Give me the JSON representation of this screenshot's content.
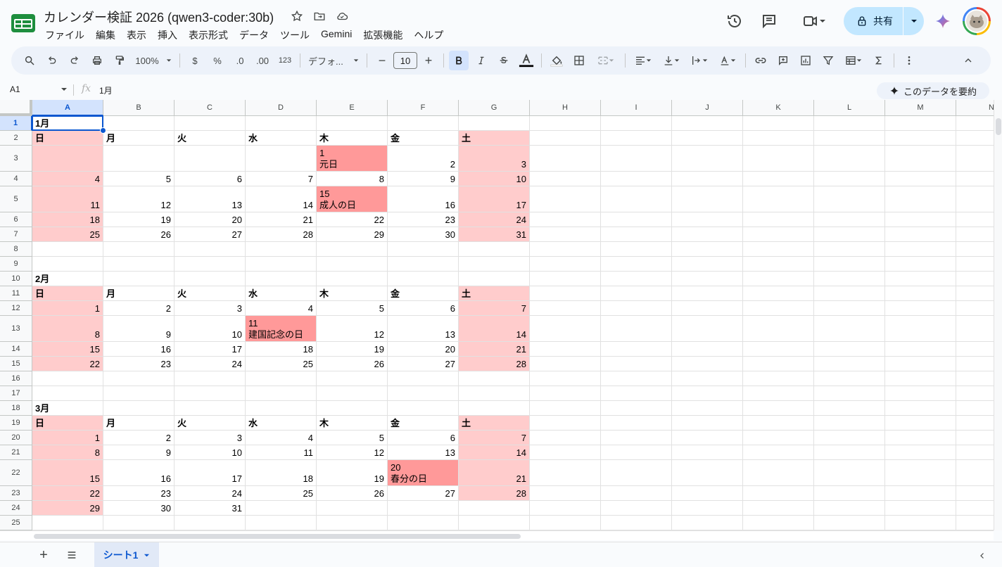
{
  "app": {
    "doc_title": "カレンダー検証 2026 (qwen3-coder:30b)",
    "menu": [
      "ファイル",
      "編集",
      "表示",
      "挿入",
      "表示形式",
      "データ",
      "ツール",
      "Gemini",
      "拡張機能",
      "ヘルプ"
    ],
    "share_label": "共有"
  },
  "toolbar": {
    "zoom": "100%",
    "currency": "$",
    "percent": "%",
    "dec_decrease": ".0",
    "dec_increase": ".00",
    "format_123": "123",
    "font_name": "デフォ...",
    "font_size": "10",
    "minus": "−",
    "plus": "+"
  },
  "formula_bar": {
    "name_box": "A1",
    "fx": "fx",
    "value": "1月",
    "summarize_label": "このデータを要約"
  },
  "grid": {
    "columns": [
      "A",
      "B",
      "C",
      "D",
      "E",
      "F",
      "G",
      "H",
      "I",
      "J",
      "K",
      "L",
      "M",
      "N"
    ],
    "rows": [
      "1",
      "2",
      "3",
      "4",
      "5",
      "6",
      "7",
      "8",
      "9",
      "10",
      "11",
      "12",
      "13",
      "14",
      "15",
      "16",
      "17",
      "18",
      "19",
      "20",
      "21",
      "22",
      "23",
      "24",
      "25"
    ],
    "selected_cell": "A1",
    "cells": [
      {
        "r": 1,
        "c": 0,
        "v": "1月",
        "bold": true
      },
      {
        "r": 2,
        "c": 0,
        "v": "日",
        "bold": true,
        "bg": "we"
      },
      {
        "r": 2,
        "c": 1,
        "v": "月",
        "bold": true
      },
      {
        "r": 2,
        "c": 2,
        "v": "火",
        "bold": true
      },
      {
        "r": 2,
        "c": 3,
        "v": "水",
        "bold": true
      },
      {
        "r": 2,
        "c": 4,
        "v": "木",
        "bold": true
      },
      {
        "r": 2,
        "c": 5,
        "v": "金",
        "bold": true
      },
      {
        "r": 2,
        "c": 6,
        "v": "土",
        "bold": true,
        "bg": "we"
      },
      {
        "r": 3,
        "c": 0,
        "v": "",
        "bg": "we"
      },
      {
        "r": 3,
        "c": 4,
        "v": "1\n元日",
        "bg": "hol",
        "multi": true
      },
      {
        "r": 3,
        "c": 5,
        "v": "2"
      },
      {
        "r": 3,
        "c": 6,
        "v": "3",
        "bg": "we"
      },
      {
        "r": 4,
        "c": 0,
        "v": "4",
        "bg": "we"
      },
      {
        "r": 4,
        "c": 1,
        "v": "5"
      },
      {
        "r": 4,
        "c": 2,
        "v": "6"
      },
      {
        "r": 4,
        "c": 3,
        "v": "7"
      },
      {
        "r": 4,
        "c": 4,
        "v": "8"
      },
      {
        "r": 4,
        "c": 5,
        "v": "9"
      },
      {
        "r": 4,
        "c": 6,
        "v": "10",
        "bg": "we"
      },
      {
        "r": 5,
        "c": 0,
        "v": "11",
        "bg": "we"
      },
      {
        "r": 5,
        "c": 1,
        "v": "12"
      },
      {
        "r": 5,
        "c": 2,
        "v": "13"
      },
      {
        "r": 5,
        "c": 3,
        "v": "14"
      },
      {
        "r": 5,
        "c": 4,
        "v": "15\n成人の日",
        "bg": "hol",
        "multi": true
      },
      {
        "r": 5,
        "c": 5,
        "v": "16"
      },
      {
        "r": 5,
        "c": 6,
        "v": "17",
        "bg": "we"
      },
      {
        "r": 6,
        "c": 0,
        "v": "18",
        "bg": "we"
      },
      {
        "r": 6,
        "c": 1,
        "v": "19"
      },
      {
        "r": 6,
        "c": 2,
        "v": "20"
      },
      {
        "r": 6,
        "c": 3,
        "v": "21"
      },
      {
        "r": 6,
        "c": 4,
        "v": "22"
      },
      {
        "r": 6,
        "c": 5,
        "v": "23"
      },
      {
        "r": 6,
        "c": 6,
        "v": "24",
        "bg": "we"
      },
      {
        "r": 7,
        "c": 0,
        "v": "25",
        "bg": "we"
      },
      {
        "r": 7,
        "c": 1,
        "v": "26"
      },
      {
        "r": 7,
        "c": 2,
        "v": "27"
      },
      {
        "r": 7,
        "c": 3,
        "v": "28"
      },
      {
        "r": 7,
        "c": 4,
        "v": "29"
      },
      {
        "r": 7,
        "c": 5,
        "v": "30"
      },
      {
        "r": 7,
        "c": 6,
        "v": "31",
        "bg": "we"
      },
      {
        "r": 10,
        "c": 0,
        "v": "2月",
        "bold": true
      },
      {
        "r": 11,
        "c": 0,
        "v": "日",
        "bold": true,
        "bg": "we"
      },
      {
        "r": 11,
        "c": 1,
        "v": "月",
        "bold": true
      },
      {
        "r": 11,
        "c": 2,
        "v": "火",
        "bold": true
      },
      {
        "r": 11,
        "c": 3,
        "v": "水",
        "bold": true
      },
      {
        "r": 11,
        "c": 4,
        "v": "木",
        "bold": true
      },
      {
        "r": 11,
        "c": 5,
        "v": "金",
        "bold": true
      },
      {
        "r": 11,
        "c": 6,
        "v": "土",
        "bold": true,
        "bg": "we"
      },
      {
        "r": 12,
        "c": 0,
        "v": "1",
        "bg": "we"
      },
      {
        "r": 12,
        "c": 1,
        "v": "2"
      },
      {
        "r": 12,
        "c": 2,
        "v": "3"
      },
      {
        "r": 12,
        "c": 3,
        "v": "4"
      },
      {
        "r": 12,
        "c": 4,
        "v": "5"
      },
      {
        "r": 12,
        "c": 5,
        "v": "6"
      },
      {
        "r": 12,
        "c": 6,
        "v": "7",
        "bg": "we"
      },
      {
        "r": 13,
        "c": 0,
        "v": "8",
        "bg": "we"
      },
      {
        "r": 13,
        "c": 1,
        "v": "9"
      },
      {
        "r": 13,
        "c": 2,
        "v": "10"
      },
      {
        "r": 13,
        "c": 3,
        "v": "11\n建国記念の日",
        "bg": "hol",
        "multi": true
      },
      {
        "r": 13,
        "c": 4,
        "v": "12"
      },
      {
        "r": 13,
        "c": 5,
        "v": "13"
      },
      {
        "r": 13,
        "c": 6,
        "v": "14",
        "bg": "we"
      },
      {
        "r": 14,
        "c": 0,
        "v": "15",
        "bg": "we"
      },
      {
        "r": 14,
        "c": 1,
        "v": "16"
      },
      {
        "r": 14,
        "c": 2,
        "v": "17"
      },
      {
        "r": 14,
        "c": 3,
        "v": "18"
      },
      {
        "r": 14,
        "c": 4,
        "v": "19"
      },
      {
        "r": 14,
        "c": 5,
        "v": "20"
      },
      {
        "r": 14,
        "c": 6,
        "v": "21",
        "bg": "we"
      },
      {
        "r": 15,
        "c": 0,
        "v": "22",
        "bg": "we"
      },
      {
        "r": 15,
        "c": 1,
        "v": "23"
      },
      {
        "r": 15,
        "c": 2,
        "v": "24"
      },
      {
        "r": 15,
        "c": 3,
        "v": "25"
      },
      {
        "r": 15,
        "c": 4,
        "v": "26"
      },
      {
        "r": 15,
        "c": 5,
        "v": "27"
      },
      {
        "r": 15,
        "c": 6,
        "v": "28",
        "bg": "we"
      },
      {
        "r": 18,
        "c": 0,
        "v": "3月",
        "bold": true
      },
      {
        "r": 19,
        "c": 0,
        "v": "日",
        "bold": true,
        "bg": "we"
      },
      {
        "r": 19,
        "c": 1,
        "v": "月",
        "bold": true
      },
      {
        "r": 19,
        "c": 2,
        "v": "火",
        "bold": true
      },
      {
        "r": 19,
        "c": 3,
        "v": "水",
        "bold": true
      },
      {
        "r": 19,
        "c": 4,
        "v": "木",
        "bold": true
      },
      {
        "r": 19,
        "c": 5,
        "v": "金",
        "bold": true
      },
      {
        "r": 19,
        "c": 6,
        "v": "土",
        "bold": true,
        "bg": "we"
      },
      {
        "r": 20,
        "c": 0,
        "v": "1",
        "bg": "we"
      },
      {
        "r": 20,
        "c": 1,
        "v": "2"
      },
      {
        "r": 20,
        "c": 2,
        "v": "3"
      },
      {
        "r": 20,
        "c": 3,
        "v": "4"
      },
      {
        "r": 20,
        "c": 4,
        "v": "5"
      },
      {
        "r": 20,
        "c": 5,
        "v": "6"
      },
      {
        "r": 20,
        "c": 6,
        "v": "7",
        "bg": "we"
      },
      {
        "r": 21,
        "c": 0,
        "v": "8",
        "bg": "we"
      },
      {
        "r": 21,
        "c": 1,
        "v": "9"
      },
      {
        "r": 21,
        "c": 2,
        "v": "10"
      },
      {
        "r": 21,
        "c": 3,
        "v": "11"
      },
      {
        "r": 21,
        "c": 4,
        "v": "12"
      },
      {
        "r": 21,
        "c": 5,
        "v": "13"
      },
      {
        "r": 21,
        "c": 6,
        "v": "14",
        "bg": "we"
      },
      {
        "r": 22,
        "c": 0,
        "v": "15",
        "bg": "we"
      },
      {
        "r": 22,
        "c": 1,
        "v": "16"
      },
      {
        "r": 22,
        "c": 2,
        "v": "17"
      },
      {
        "r": 22,
        "c": 3,
        "v": "18"
      },
      {
        "r": 22,
        "c": 4,
        "v": "19"
      },
      {
        "r": 22,
        "c": 5,
        "v": "20\n春分の日",
        "bg": "hol",
        "multi": true
      },
      {
        "r": 22,
        "c": 6,
        "v": "21",
        "bg": "we"
      },
      {
        "r": 23,
        "c": 0,
        "v": "22",
        "bg": "we"
      },
      {
        "r": 23,
        "c": 1,
        "v": "23"
      },
      {
        "r": 23,
        "c": 2,
        "v": "24"
      },
      {
        "r": 23,
        "c": 3,
        "v": "25"
      },
      {
        "r": 23,
        "c": 4,
        "v": "26"
      },
      {
        "r": 23,
        "c": 5,
        "v": "27"
      },
      {
        "r": 23,
        "c": 6,
        "v": "28",
        "bg": "we"
      },
      {
        "r": 24,
        "c": 0,
        "v": "29",
        "bg": "we"
      },
      {
        "r": 24,
        "c": 1,
        "v": "30"
      },
      {
        "r": 24,
        "c": 2,
        "v": "31"
      }
    ]
  },
  "sheets": {
    "add": "+",
    "active_tab": "シート1"
  },
  "colors": {
    "weekend_bg": "#ffcccc",
    "holiday_bg": "#ff9999",
    "accent": "#0b57d0",
    "share_bg": "#c2e7ff"
  }
}
